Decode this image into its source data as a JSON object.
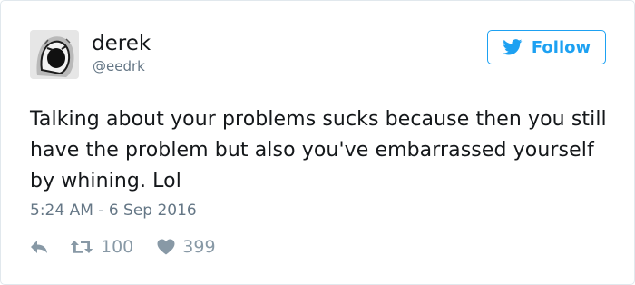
{
  "tweet": {
    "author": {
      "display_name": "derek",
      "handle": "@eedrk",
      "avatar_icon": "screaming-face-avatar"
    },
    "follow_button": {
      "label": "Follow",
      "icon": "twitter-bird-icon",
      "color": "#1da1f2"
    },
    "text": "Talking about your problems sucks because then you still have the problem but also you've embarrassed yourself by whining. Lol",
    "timestamp": "5:24 AM - 6 Sep 2016",
    "actions": {
      "reply_icon": "reply-icon",
      "retweet_icon": "retweet-icon",
      "retweet_count": "100",
      "like_icon": "heart-icon",
      "like_count": "399"
    }
  }
}
